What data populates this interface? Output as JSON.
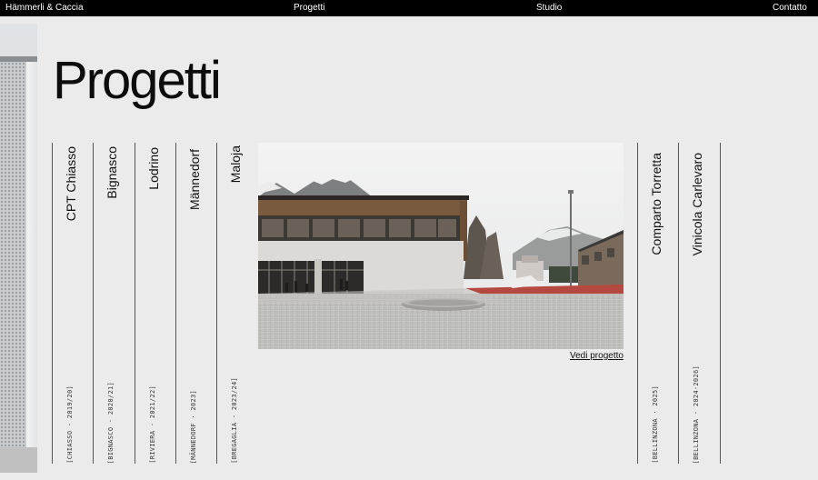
{
  "nav": {
    "brand": "Hämmerli & Caccia",
    "projects": "Progetti",
    "studio": "Studio",
    "contact": "Contatto"
  },
  "page": {
    "title": "Progetti"
  },
  "projects": [
    {
      "name": "CPT Chiasso",
      "meta": "[CHIASSO · 2019/20]"
    },
    {
      "name": "Bignasco",
      "meta": "[BIGNASCO · 2020/21]"
    },
    {
      "name": "Lodrino",
      "meta": "[RIVIERA · 2021/22]"
    },
    {
      "name": "Männedorf",
      "meta": "[MÄNNEDORF · 2023]"
    },
    {
      "name": "Maloja",
      "meta": "[BREGAGLIA · 2023/24]"
    },
    {
      "name": "Comparto Torretta",
      "meta": "[BELLINZONA · 2025]"
    },
    {
      "name": "Vinicola Carlevaro",
      "meta": "[BELLINZONA · 2024-2026]"
    }
  ],
  "feature": {
    "link": "Vedi progetto"
  },
  "colors": {
    "topbar": "#000000",
    "background": "#ebebeb",
    "track": "#b5483f"
  }
}
